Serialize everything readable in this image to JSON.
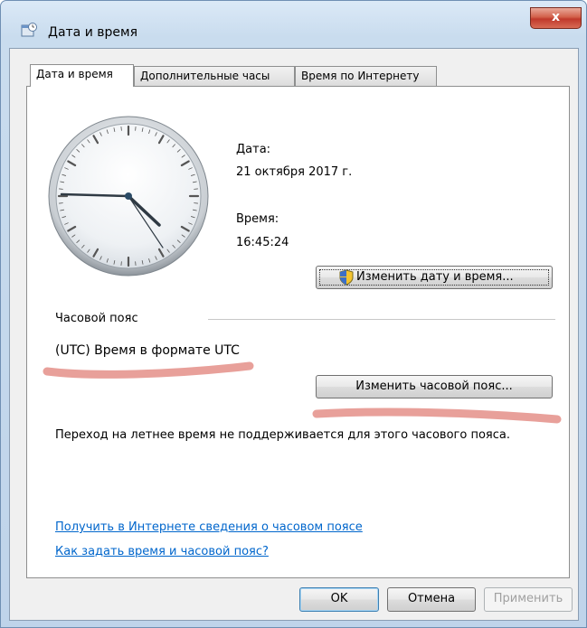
{
  "window": {
    "title": "Дата и время",
    "close_label": "x"
  },
  "tabs": [
    {
      "label": "Дата и время",
      "active": true
    },
    {
      "label": "Дополнительные часы",
      "active": false
    },
    {
      "label": "Время по Интернету",
      "active": false
    }
  ],
  "datetime": {
    "date_label": "Дата:",
    "date_value": "21 октября 2017 г.",
    "time_label": "Время:",
    "time_value": "16:45:24",
    "change_datetime_button": "Изменить дату и время..."
  },
  "timezone": {
    "section_label": "Часовой пояс",
    "value": "(UTC) Время в формате UTC",
    "change_timezone_button": "Изменить часовой пояс...",
    "dst_note": "Переход на летнее время не поддерживается для этого часового пояса."
  },
  "links": {
    "online_info": "Получить в Интернете сведения о часовом поясе",
    "how_to_set": "Как задать время и часовой пояс?"
  },
  "footer": {
    "ok": "OK",
    "cancel": "Отмена",
    "apply": "Применить"
  },
  "icons": {
    "window": "datetime-icon",
    "shield": "uac-shield-icon"
  },
  "colors": {
    "highlight_marks": "#e8a09a",
    "link": "#0066cc"
  }
}
